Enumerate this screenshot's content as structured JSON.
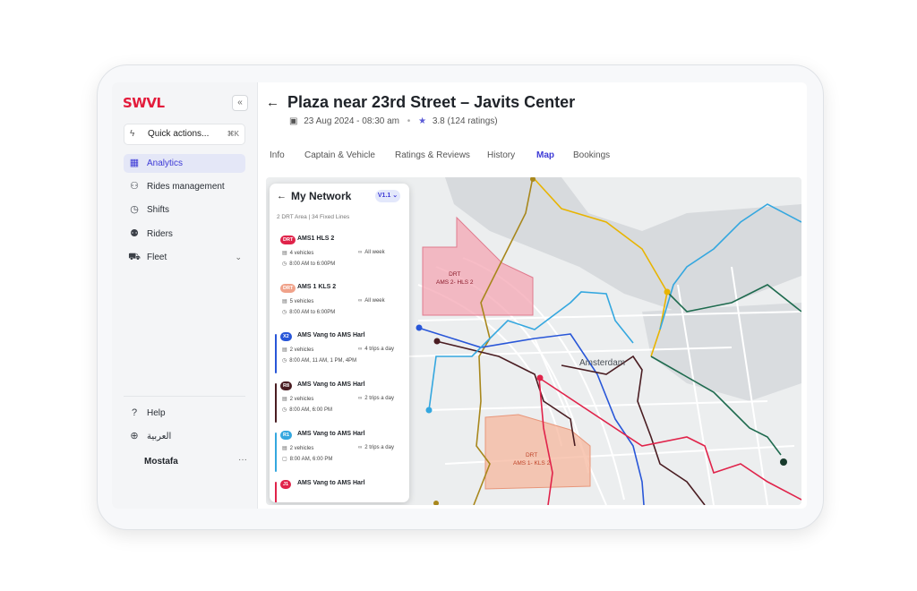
{
  "app": {
    "logo": "SWVL",
    "collapse_icon": "«"
  },
  "quick_actions": {
    "label": "Quick actions...",
    "shortcut": "⌘K"
  },
  "sidebar": {
    "items": [
      {
        "label": "Analytics",
        "icon": "analytics-icon",
        "glyph": "▦",
        "active": true
      },
      {
        "label": "Rides management",
        "icon": "rides-icon",
        "glyph": "⚇",
        "active": false
      },
      {
        "label": "Shifts",
        "icon": "clock-icon",
        "glyph": "◷",
        "active": false
      },
      {
        "label": "Riders",
        "icon": "riders-icon",
        "glyph": "⚉",
        "active": false
      },
      {
        "label": "Fleet",
        "icon": "car-icon",
        "glyph": "⛟",
        "active": false
      }
    ],
    "bottom": [
      {
        "label": "Help",
        "icon": "help-icon",
        "glyph": "?"
      },
      {
        "label": "العربية",
        "icon": "globe-icon",
        "glyph": "⊕"
      }
    ],
    "user": {
      "name": "Mostafa",
      "more": "···"
    }
  },
  "header": {
    "back_icon": "←",
    "title": "Plaza near 23rd Street – Javits Center",
    "date": "23 Aug 2024 - 08:30 am",
    "rating": "3.8",
    "rating_count": "(124 ratings)"
  },
  "tabs": [
    {
      "label": "Info",
      "active": false
    },
    {
      "label": "Captain & Vehicle",
      "active": false
    },
    {
      "label": "Ratings & Reviews",
      "active": false
    },
    {
      "label": "History",
      "active": false
    },
    {
      "label": "Map",
      "active": true
    },
    {
      "label": "Bookings",
      "active": false
    }
  ],
  "panel": {
    "title": "My Network",
    "version": "V1.1",
    "summary": "2 DRT Area  |  34 Fixed Lines",
    "lines": [
      {
        "badge": "DRT",
        "badge_color": "#e0234a",
        "name": "AMS1  HLS 2",
        "vehicles": "4 vehicles",
        "freq": "All week",
        "time": "8:00 AM to 6:00PM",
        "bar_color": ""
      },
      {
        "badge": "DRT",
        "badge_color": "#f0a28a",
        "name": "AMS 1  KLS 2",
        "vehicles": "5 vehicles",
        "freq": "All week",
        "time": "8:00 AM to 6:00PM",
        "bar_color": ""
      },
      {
        "badge": "X2",
        "badge_color": "#2856d8",
        "name": "AMS Vang to AMS Harl",
        "vehicles": "2 vehicles",
        "freq": "4 trips a day",
        "time": "8:00 AM, 11 AM, 1 PM, 4PM",
        "bar_color": "#2856d8"
      },
      {
        "badge": "R8",
        "badge_color": "#4a1d22",
        "name": "AMS Vang to AMS Harl",
        "vehicles": "2 vehicles",
        "freq": "2 trips a day",
        "time": "8:00 AM, 6:00 PM",
        "bar_color": "#4a1d22"
      },
      {
        "badge": "R1",
        "badge_color": "#34a7df",
        "name": "AMS Vang to AMS Harl",
        "vehicles": "2 vehicles",
        "freq": "2 trips a day",
        "time": "8:00 AM, 6:00 PM",
        "bar_color": "#34a7df"
      },
      {
        "badge": "J1",
        "badge_color": "#e0234a",
        "name": "AMS Vang to AMS Harl",
        "vehicles": "",
        "freq": "",
        "time": "",
        "bar_color": "#e0234a"
      }
    ]
  },
  "map": {
    "city_label": "Amsterdam",
    "areas": [
      {
        "line1": "DRT",
        "line2": "AMS 2- HLS 2",
        "fill": "#f4a6b3",
        "text_color": "#8a1a2a"
      },
      {
        "line1": "DRT",
        "line2": "AMS 1- KLS 2",
        "fill": "#f5b79e",
        "text_color": "#c0452a"
      }
    ],
    "route_colors": {
      "yellow": "#e8b400",
      "olive": "#a8871c",
      "blue": "#2856d8",
      "maroon": "#4a1d22",
      "red": "#e0234a",
      "cyan": "#34a7df",
      "green": "#1f6b4f"
    }
  },
  "colors": {
    "accent": "#3d3ad6",
    "brand": "#e31b3b"
  }
}
